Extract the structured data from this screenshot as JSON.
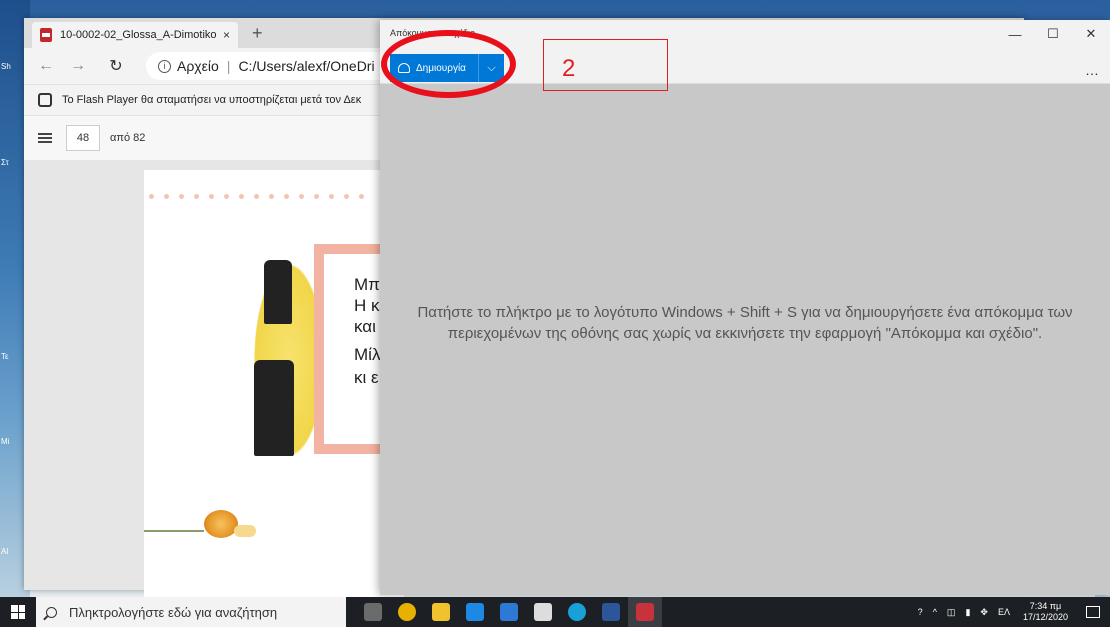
{
  "desktop": {
    "side_labels": [
      "Sh",
      "Στ",
      "Τε",
      "Mi",
      "Al"
    ]
  },
  "browser": {
    "tab_title": "10-0002-02_Glossa_A-Dimotikor",
    "tab_close": "×",
    "new_tab": "+",
    "back": "←",
    "forward": "→",
    "refresh": "↻",
    "url_scheme": "Αρχείο",
    "url_path": "C:/Users/alexf/OneDri",
    "infobar_text": "Το Flash Player θα σταματήσει να υποστηρίζεται μετά τον Δεκ",
    "page_number": "48",
    "page_of": "από 82"
  },
  "pdf_page": {
    "lines": [
      "Μπ",
      "Η κ",
      "και",
      "Μίλ",
      "κι ε"
    ]
  },
  "snip": {
    "title": "Απόκομμα και σχέδιο",
    "new_label": "Δημιουργία",
    "dropdown": "⌵",
    "more": "…",
    "minimize": "—",
    "maximize": "☐",
    "close": "✕",
    "message": "Πατήστε το πλήκτρο με το λογότυπο Windows + Shift + S για να δημιουργήσετε ένα απόκομμα των περιεχομένων της οθόνης σας χωρίς να εκκινήσετε την εφαρμογή \"Απόκομμα και σχέδιο\"."
  },
  "annotation": {
    "step_number": "2",
    "color": "#e01f25"
  },
  "taskbar": {
    "search_placeholder": "Πληκτρολογήστε εδώ για αναζήτηση",
    "lang": "ΕΛ",
    "time": "7:34 πμ",
    "date": "17/12/2020",
    "icons": [
      "task-view",
      "chrome",
      "file-explorer",
      "store",
      "mail",
      "app-arrow",
      "edge",
      "word",
      "snip-sketch"
    ],
    "icon_colors": [
      "#6b6b6b",
      "#e8b100",
      "#f2c12e",
      "#1e88e5",
      "#2d7ad6",
      "#dddddd",
      "#1aa0d8",
      "#2b579a",
      "#c8323a"
    ]
  }
}
